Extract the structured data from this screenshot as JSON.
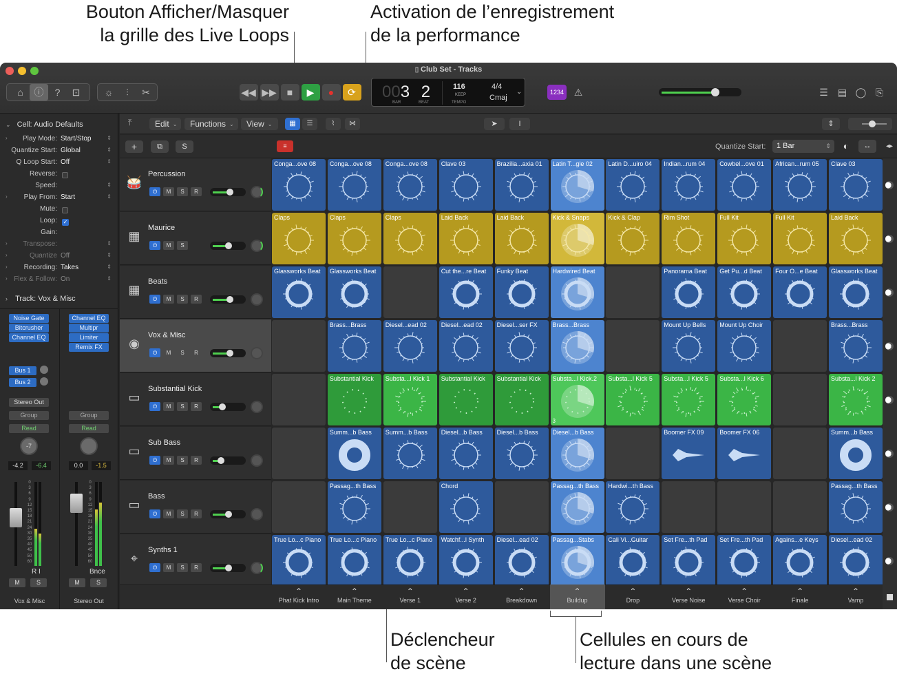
{
  "callouts": {
    "grid_toggle": [
      "Bouton Afficher/Masquer",
      "la grille des Live Loops"
    ],
    "perf_record": [
      "Activation de l’enregistrement",
      "de la performance"
    ],
    "scene_trigger": [
      "Déclencheur",
      "de scène"
    ],
    "playing_cells": [
      "Cellules en cours de",
      "lecture dans une scène"
    ]
  },
  "window": {
    "title": "Club Set - Tracks"
  },
  "lcd": {
    "bars_dim": "00",
    "bar": "3",
    "beat": "2",
    "bar_label": "BAR",
    "beat_label": "BEAT",
    "tempo": "116",
    "keep": "KEEP",
    "tempo_label": "TEMPO",
    "signature": "4/4",
    "key": "Cmaj"
  },
  "toolbar": {
    "count_in": "1234"
  },
  "control_bar": {
    "edit": "Edit",
    "functions": "Functions",
    "view": "View",
    "quantize_label": "Quantize Start:",
    "quantize_value": "1 Bar"
  },
  "subbar": {
    "solo": "S"
  },
  "inspector": {
    "cell_header_label": "Cell:",
    "cell_header_value": "Audio Defaults",
    "rows": [
      {
        "k": "Play Mode:",
        "v": "Start/Stop"
      },
      {
        "k": "Quantize Start:",
        "v": "Global"
      },
      {
        "k": "Q Loop Start:",
        "v": "Off"
      },
      {
        "k": "Reverse:",
        "v": ""
      },
      {
        "k": "Speed:",
        "v": ""
      },
      {
        "k": "Play From:",
        "v": "Start"
      },
      {
        "k": "Mute:",
        "v": ""
      },
      {
        "k": "Loop:",
        "v": ""
      },
      {
        "k": "Gain:",
        "v": ""
      },
      {
        "k": "Transpose:",
        "v": ""
      },
      {
        "k": "Quantize",
        "v": "Off"
      },
      {
        "k": "Recording:",
        "v": "Takes"
      },
      {
        "k": "Flex & Follow:",
        "v": "On"
      }
    ],
    "track_header_label": "Track:",
    "track_header_value": "Vox & Misc",
    "left_plugins": [
      "Noise Gate",
      "Bitcrusher",
      "Channel EQ"
    ],
    "right_plugins": [
      "Channel EQ",
      "Multipr",
      "Limiter",
      "Remix FX"
    ],
    "sends": [
      "Bus 1",
      "Bus 2"
    ],
    "output": "Stereo Out",
    "group": "Group",
    "automation": "Read",
    "left_pan": "-7",
    "left_vol": "-4.2",
    "left_peak": "-6.4",
    "right_vol": "0.0",
    "right_peak": "-1.5",
    "ri": "R I",
    "bounce": "Bnce",
    "mute": "M",
    "solo": "S",
    "left_name": "Vox & Misc",
    "right_name": "Stereo Out",
    "meter_scale": [
      "0",
      "3",
      "6",
      "9",
      "12",
      "15",
      "18",
      "21",
      "24",
      "30",
      "35",
      "40",
      "45",
      "50",
      "60"
    ]
  },
  "track_buttons": {
    "power": "⏻",
    "mute": "M",
    "solo": "S",
    "record": "R"
  },
  "tracks": [
    {
      "name": "Percussion",
      "icon": "conga-icon",
      "glyph": "🥁",
      "record": true
    },
    {
      "name": "Maurice",
      "icon": "drum-machine-icon",
      "glyph": "▦",
      "record": false
    },
    {
      "name": "Beats",
      "icon": "drum-machine-icon",
      "glyph": "▦",
      "record": true
    },
    {
      "name": "Vox & Misc",
      "icon": "turntable-icon",
      "glyph": "◉",
      "record": true
    },
    {
      "name": "Substantial Kick",
      "icon": "keyboard-icon",
      "glyph": "▭",
      "record": true
    },
    {
      "name": "Sub Bass",
      "icon": "keyboard-icon",
      "glyph": "▭",
      "record": true
    },
    {
      "name": "Bass",
      "icon": "keyboard-icon",
      "glyph": "▭",
      "record": true
    },
    {
      "name": "Synths 1",
      "icon": "synth-stand-icon",
      "glyph": "⌖",
      "record": true
    }
  ],
  "scenes": [
    "Phat Kick Intro",
    "Main Theme",
    "Verse 1",
    "Verse 2",
    "Breakdown",
    "Buildup",
    "Drop",
    "Verse Noise",
    "Verse Choir",
    "Finale",
    "Vamp"
  ],
  "colors": {
    "blue": "#2e5a9c",
    "yellow": "#b59a1f",
    "green": "#2f9b3a",
    "green_bright": "#3bb546",
    "playing_blue": "#4d84cf",
    "playing_yellow": "#d2b83a",
    "playing_green": "#4ec75a"
  },
  "grid": [
    [
      {
        "label": "Conga...ove 08",
        "c": "blue"
      },
      {
        "label": "Conga...ove 08",
        "c": "blue"
      },
      {
        "label": "Conga...ove 08",
        "c": "blue"
      },
      {
        "label": "Clave 03",
        "c": "blue"
      },
      {
        "label": "Brazilia...axia 01",
        "c": "blue"
      },
      {
        "label": "Latin T...gle 02",
        "c": "blue",
        "playing": true
      },
      {
        "label": "Latin D...uiro 04",
        "c": "blue"
      },
      {
        "label": "Indian...rum 04",
        "c": "blue"
      },
      {
        "label": "Cowbel...ove 01",
        "c": "blue"
      },
      {
        "label": "African...rum 05",
        "c": "blue"
      },
      {
        "label": "Clave 03",
        "c": "blue"
      }
    ],
    [
      {
        "label": "Claps",
        "c": "yellow"
      },
      {
        "label": "Claps",
        "c": "yellow"
      },
      {
        "label": "Claps",
        "c": "yellow"
      },
      {
        "label": "Laid Back",
        "c": "yellow"
      },
      {
        "label": "Laid Back",
        "c": "yellow"
      },
      {
        "label": "Kick & Snaps",
        "c": "yellow",
        "playing": true
      },
      {
        "label": "Kick & Clap",
        "c": "yellow"
      },
      {
        "label": "Rim Shot",
        "c": "yellow"
      },
      {
        "label": "Full Kit",
        "c": "yellow"
      },
      {
        "label": "Full Kit",
        "c": "yellow"
      },
      {
        "label": "Laid Back",
        "c": "yellow"
      }
    ],
    [
      {
        "label": "Glassworks Beat",
        "c": "blue"
      },
      {
        "label": "Glassworks Beat",
        "c": "blue"
      },
      null,
      {
        "label": "Cut the...re Beat",
        "c": "blue"
      },
      {
        "label": "Funky Beat",
        "c": "blue"
      },
      {
        "label": "Hardwired Beat",
        "c": "blue",
        "playing": true
      },
      null,
      {
        "label": "Panorama Beat",
        "c": "blue"
      },
      {
        "label": "Get Pu...d Beat",
        "c": "blue"
      },
      {
        "label": "Four O...e Beat",
        "c": "blue"
      },
      {
        "label": "Glassworks Beat",
        "c": "blue"
      }
    ],
    [
      null,
      {
        "label": "Brass...Brass",
        "c": "blue"
      },
      {
        "label": "Diesel...ead 02",
        "c": "blue"
      },
      {
        "label": "Diesel...ead 02",
        "c": "blue"
      },
      {
        "label": "Diesel...ser FX",
        "c": "blue"
      },
      {
        "label": "Brass...Brass",
        "c": "blue",
        "playing": true
      },
      null,
      {
        "label": "Mount Up Bells",
        "c": "blue"
      },
      {
        "label": "Mount Up Choir",
        "c": "blue"
      },
      null,
      {
        "label": "Brass...Brass",
        "c": "blue"
      }
    ],
    [
      null,
      {
        "label": "Substantial Kick",
        "c": "green"
      },
      {
        "label": "Substa...l Kick 1",
        "c": "green_bright"
      },
      {
        "label": "Substantial Kick",
        "c": "green"
      },
      {
        "label": "Substantial Kick",
        "c": "green"
      },
      {
        "label": "Substa...l Kick.2",
        "c": "green",
        "playing": true,
        "badge": "3"
      },
      {
        "label": "Substa...l Kick 5",
        "c": "green_bright"
      },
      {
        "label": "Substa...l Kick 5",
        "c": "green_bright"
      },
      {
        "label": "Substa...l Kick 6",
        "c": "green_bright"
      },
      null,
      {
        "label": "Substa...l Kick 2",
        "c": "green_bright"
      }
    ],
    [
      null,
      {
        "label": "Summ...b Bass",
        "c": "blue"
      },
      {
        "label": "Summ...b Bass",
        "c": "blue"
      },
      {
        "label": "Diesel...b Bass",
        "c": "blue"
      },
      {
        "label": "Diesel...b Bass",
        "c": "blue"
      },
      {
        "label": "Diesel...b Bass",
        "c": "blue",
        "playing": true
      },
      null,
      {
        "label": "Boomer FX 09",
        "c": "blue"
      },
      {
        "label": "Boomer FX 06",
        "c": "blue"
      },
      null,
      {
        "label": "Summ...b Bass",
        "c": "blue"
      }
    ],
    [
      null,
      {
        "label": "Passag...th Bass",
        "c": "blue"
      },
      null,
      {
        "label": "Chord",
        "c": "blue"
      },
      null,
      {
        "label": "Passag...th Bass",
        "c": "blue",
        "playing": true
      },
      {
        "label": "Hardwi...th Bass",
        "c": "blue"
      },
      null,
      null,
      null,
      {
        "label": "Passag...th Bass",
        "c": "blue"
      }
    ],
    [
      {
        "label": "True Lo...c Piano",
        "c": "blue"
      },
      {
        "label": "True Lo...c Piano",
        "c": "blue"
      },
      {
        "label": "True Lo...c Piano",
        "c": "blue"
      },
      {
        "label": "Watchf...l Synth",
        "c": "blue"
      },
      {
        "label": "Diesel...ead 02",
        "c": "blue"
      },
      {
        "label": "Passag...Stabs",
        "c": "blue",
        "playing": true
      },
      {
        "label": "Cali Vi...Guitar",
        "c": "blue"
      },
      {
        "label": "Set Fre...th Pad",
        "c": "blue"
      },
      {
        "label": "Set Fre...th Pad",
        "c": "blue"
      },
      {
        "label": "Agains...e Keys",
        "c": "blue"
      },
      {
        "label": "Diesel...ead 02",
        "c": "blue"
      }
    ]
  ]
}
